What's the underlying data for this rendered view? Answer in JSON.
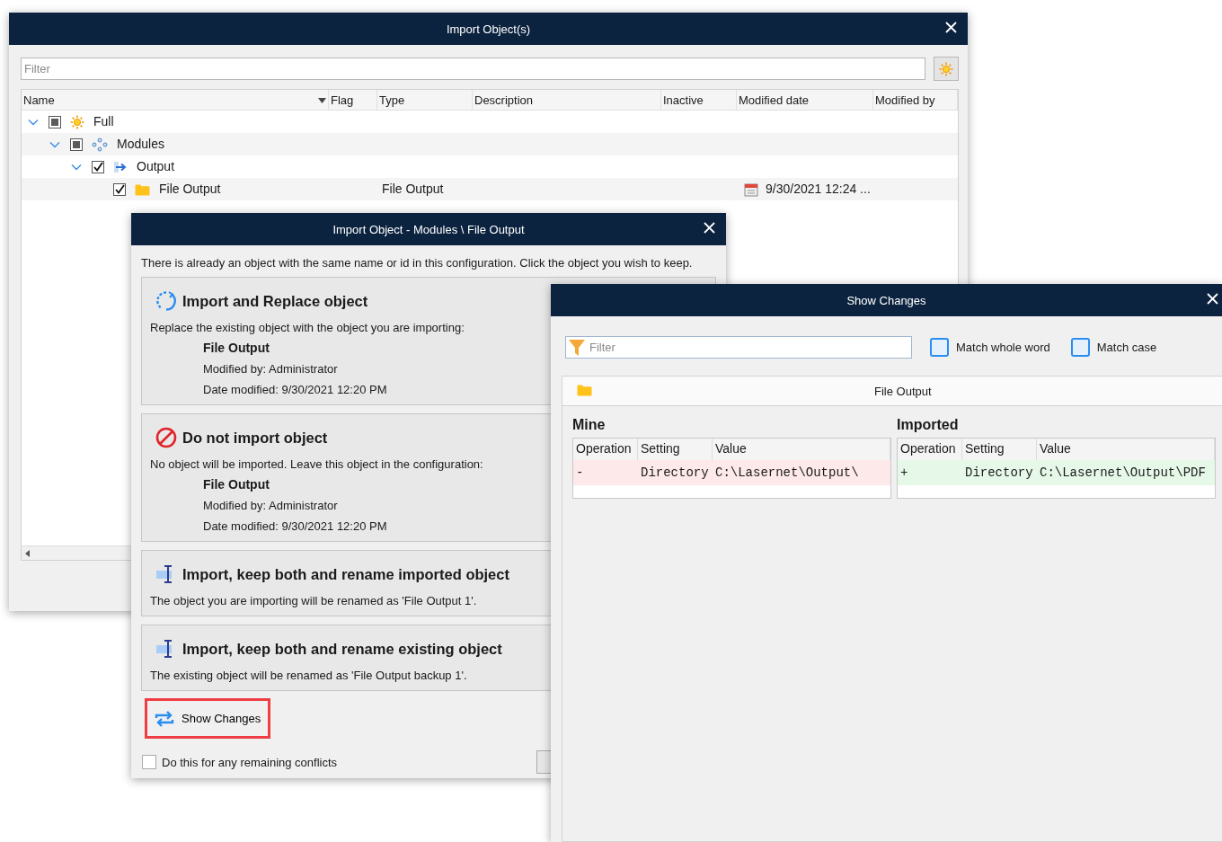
{
  "main_window": {
    "title": "Import Object(s)",
    "filter": {
      "placeholder": "Filter"
    },
    "columns": [
      "Name",
      "Flag",
      "Type",
      "Description",
      "Inactive",
      "Modified date",
      "Modified by"
    ],
    "tree": [
      {
        "label": "Full",
        "kind": "sun",
        "checked": false,
        "indeterminate": true,
        "expanded": true,
        "children": [
          {
            "label": "Modules",
            "kind": "modules",
            "checked": false,
            "indeterminate": true,
            "expanded": true,
            "children": [
              {
                "label": "Output",
                "kind": "output",
                "checked": true,
                "expanded": true,
                "children": [
                  {
                    "label": "File Output",
                    "kind": "folder",
                    "checked": true,
                    "type": "File Output",
                    "modified_date": "9/30/2021 12:24 ..."
                  }
                ]
              }
            ]
          }
        ]
      }
    ]
  },
  "dialog": {
    "title": "Import Object - Modules \\ File Output",
    "intro": "There is already an object with the same name or id in this configuration. Click the object you wish to keep.",
    "options": [
      {
        "kind": "replace",
        "title": "Import and Replace object",
        "description": "Replace the existing object with the object you are importing:",
        "object_name": "File Output",
        "modified_by": "Modified by: Administrator",
        "date_modified": "Date modified: 9/30/2021 12:20 PM"
      },
      {
        "kind": "skip",
        "title": "Do not import object",
        "description": "No object will be imported. Leave this object in the configuration:",
        "object_name": "File Output",
        "modified_by": "Modified by: Administrator",
        "date_modified": "Date modified: 9/30/2021 12:20 PM"
      },
      {
        "kind": "rename",
        "title": "Import, keep both and rename imported object",
        "description": "The object you are importing will be renamed as 'File Output 1'."
      },
      {
        "kind": "rename",
        "title": "Import, keep both and rename existing object",
        "description": "The existing object will be renamed as 'File Output backup 1'."
      }
    ],
    "show_changes_button": "Show Changes",
    "remaining_checkbox": {
      "label": "Do this for any remaining conflicts",
      "checked": false
    }
  },
  "show_changes": {
    "title": "Show Changes",
    "filter": {
      "placeholder": "Filter"
    },
    "options": [
      {
        "label": "Match whole word",
        "checked": false
      },
      {
        "label": "Match case",
        "checked": false
      }
    ],
    "object_name": "File Output",
    "panes": [
      {
        "heading": "Mine",
        "columns": [
          "Operation",
          "Setting",
          "Value"
        ],
        "rows": [
          {
            "operation": "-",
            "setting": "Directory",
            "value": "C:\\Lasernet\\Output\\",
            "kind": "removed"
          }
        ]
      },
      {
        "heading": "Imported",
        "columns": [
          "Operation",
          "Setting",
          "Value"
        ],
        "rows": [
          {
            "operation": "+",
            "setting": "Directory",
            "value": "C:\\Lasernet\\Output\\PDF",
            "kind": "added"
          }
        ]
      }
    ]
  }
}
